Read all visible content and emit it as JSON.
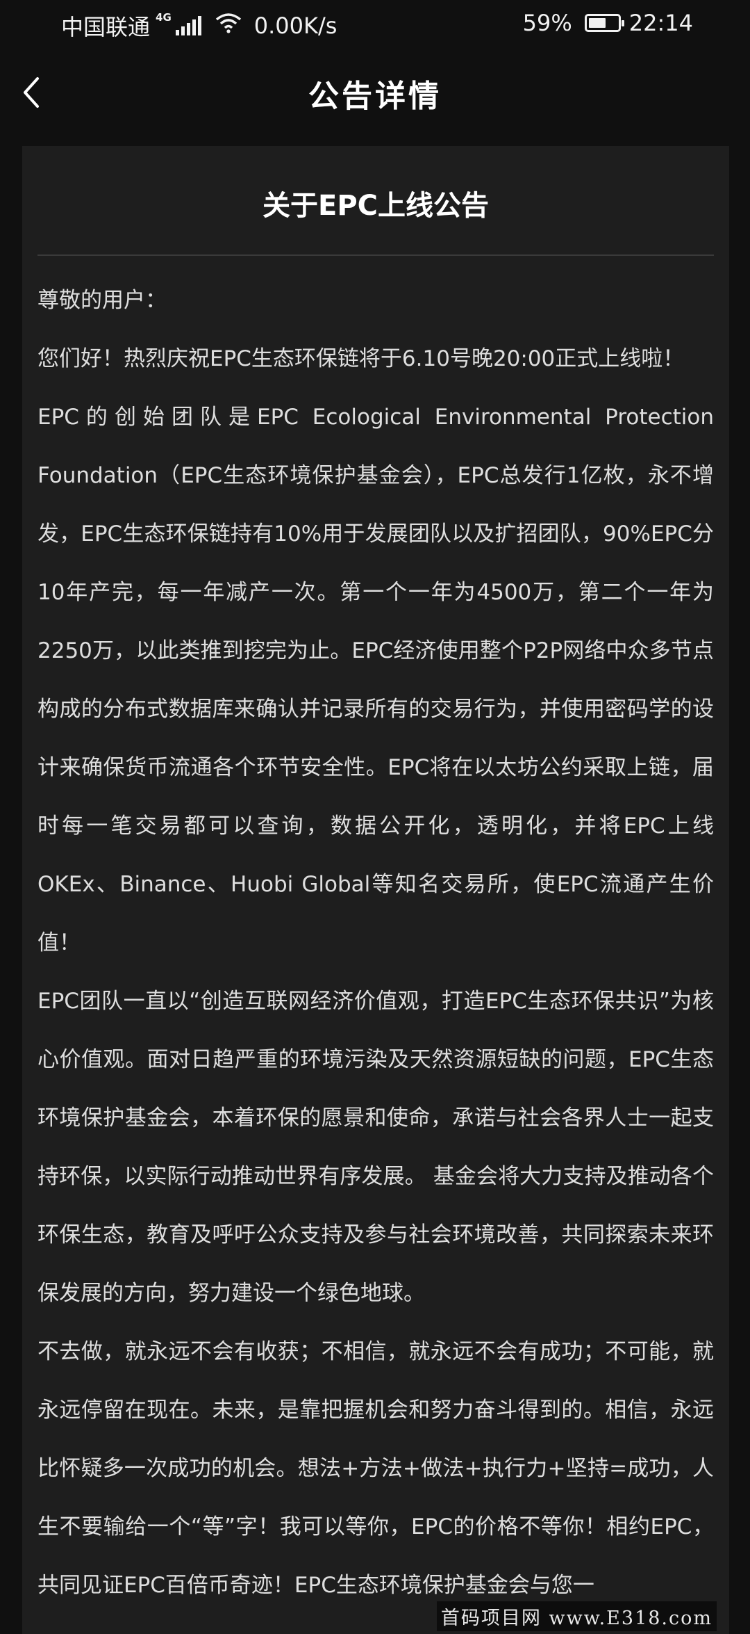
{
  "status_bar": {
    "carrier": "中国联通",
    "network_type": "4G",
    "net_speed": "0.00K/s",
    "battery_percent_label": "59%",
    "battery_level": 0.59,
    "time": "22:14",
    "icons": [
      "signal-icon",
      "wifi-icon",
      "battery-icon"
    ]
  },
  "nav": {
    "back_icon": "chevron-left-icon",
    "title": "公告详情"
  },
  "article": {
    "title": "关于EPC上线公告",
    "paragraphs": [
      "尊敬的用户：",
      "您们好！热烈庆祝EPC生态环保链将于6.10号晚20:00正式上线啦！",
      "EPC的创始团队是EPC Ecological Environmental Protection Foundation（EPC生态环境保护基金会），EPC总发行1亿枚，永不增发，EPC生态环保链持有10%用于发展团队以及扩招团队，90%EPC分10年产完，每一年减产一次。第一个一年为4500万，第二个一年为2250万，以此类推到挖完为止。EPC经济使用整个P2P网络中众多节点构成的分布式数据库来确认并记录所有的交易行为，并使用密码学的设计来确保货币流通各个环节安全性。EPC将在以太坊公约采取上链，届时每一笔交易都可以查询，数据公开化，透明化，并将EPC上线OKEx、Binance、Huobi Global等知名交易所，使EPC流通产生价值！",
      " EPC团队一直以“创造互联网经济价值观，打造EPC生态环保共识”为核心价值观。面对日趋严重的环境污染及天然资源短缺的问题，EPC生态环境保护基金会，本着环保的愿景和使命，承诺与社会各界人士一起支持环保，以实际行动推动世界有序发展。 基金会将大力支持及推动各个环保生态，教育及呼吁公众支持及参与社会环境改善，共同探索未来环保发展的方向，努力建设一个绿色地球。",
      "不去做，就永远不会有收获；不相信，就永远不会有成功；不可能，就永远停留在现在。未来，是靠把握机会和努力奋斗得到的。相信，永远比怀疑多一次成功的机会。想法+方法+做法+执行力+坚持=成功，人生不要输给一个“等”字！我可以等你，EPC的价格不等你！相约EPC，共同见证EPC百倍币奇迹！EPC生态环境保护基金会与您一"
    ]
  },
  "watermark": "首码项目网 www.E318.com"
}
